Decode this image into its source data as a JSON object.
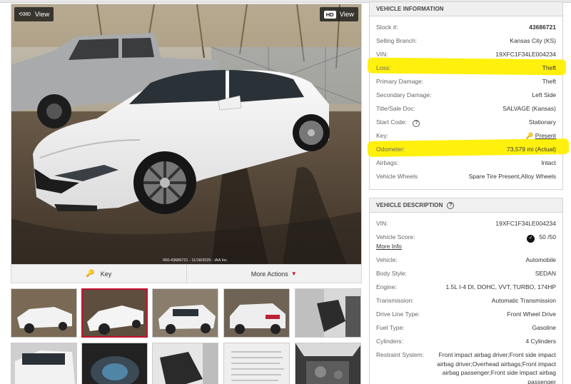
{
  "photo": {
    "rotate_label": "360",
    "view_label_left": "View",
    "hd_label": "HD",
    "view_label_right": "View",
    "caption": "000-43686721 - 11/18/2025 - IAA Inc."
  },
  "actions": {
    "key_label": "Key",
    "more_label": "More Actions"
  },
  "vehicle_info": {
    "title": "VEHICLE INFORMATION",
    "rows": [
      {
        "label": "Stock #:",
        "value": "43686721"
      },
      {
        "label": "Selling Branch:",
        "value": "Kansas City (KS)"
      },
      {
        "label": "VIN:",
        "value": "19XFC1F34LE004234"
      },
      {
        "label": "Loss:",
        "value": "Theft"
      },
      {
        "label": "Primary Damage:",
        "value": "Theft"
      },
      {
        "label": "Secondary Damage:",
        "value": "Left Side"
      },
      {
        "label": "Title/Sale Doc:",
        "value": "SALVAGE (Kansas)"
      },
      {
        "label": "Start Code:",
        "value": "Stationary"
      },
      {
        "label": "Key:",
        "value": "Present"
      },
      {
        "label": "Odometer:",
        "value": "73,579 mi (Actual)"
      },
      {
        "label": "Airbags:",
        "value": "Intact"
      },
      {
        "label": "Vehicle Wheels",
        "value": "Spare Tire Present,Alloy Wheels"
      }
    ]
  },
  "vehicle_desc": {
    "title": "VEHICLE DESCRIPTION",
    "vin_label": "VIN:",
    "vin_value": "19XFC1F34LE004234",
    "score_label": "Vehicle Score:",
    "score_value": "50 /50",
    "more_info": "More Info",
    "rows": [
      {
        "label": "Vehicle:",
        "value": "Automobile"
      },
      {
        "label": "Body Style:",
        "value": "SEDAN"
      },
      {
        "label": "Engine:",
        "value": "1.5L I-4 DI, DOHC, VVT, TURBO, 174HP"
      },
      {
        "label": "Transmission:",
        "value": "Automatic Transmission"
      },
      {
        "label": "Drive Line Type:",
        "value": "Front Wheel Drive"
      },
      {
        "label": "Fuel Type:",
        "value": "Gasoline"
      },
      {
        "label": "Cylinders:",
        "value": "4 Cylinders"
      }
    ],
    "restraint_label": "Restraint System:",
    "restraint_lines": [
      "Front impact airbag driver;Front side impact",
      "airbag driver;Overhead airbags;Front impact",
      "airbag passenger;Front side impact airbag",
      "passenger"
    ]
  },
  "colors": {
    "highlight": "#ffef00",
    "accent": "#c8102e",
    "car": "#f4f4f2"
  },
  "icons": {
    "rotate": "360-rotate-icon",
    "key": "key-icon",
    "chevron": "chevron-down-icon",
    "help": "help-circle-icon",
    "check": "check-badge-icon"
  }
}
